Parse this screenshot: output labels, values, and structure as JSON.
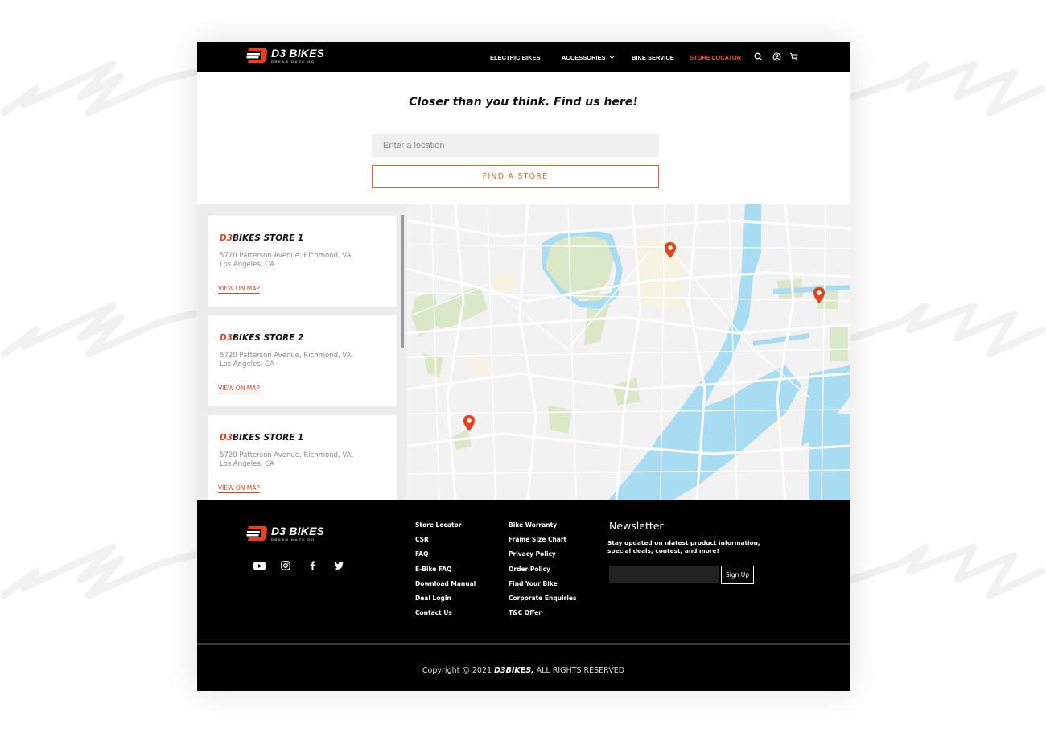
{
  "brand": {
    "name": "D3 BIKES",
    "tagline": "DREAM  DARE  DO",
    "accent_color": "#e3421b"
  },
  "nav": {
    "items": [
      {
        "label": "ELECTRIC BIKES",
        "active": false
      },
      {
        "label": "ACCESSORIES",
        "active": false,
        "has_dropdown": true
      },
      {
        "label": "BIKE SERVICE",
        "active": false
      },
      {
        "label": "STORE LOCATOR",
        "active": true
      }
    ],
    "icons": [
      "search-icon",
      "account-icon",
      "cart-icon"
    ]
  },
  "hero": {
    "title": "Closer than you think. Find us here!",
    "location_placeholder": "Enter a location",
    "location_value": "",
    "find_button": "FIND A STORE"
  },
  "stores": [
    {
      "brand": "D3",
      "name": "BIKES STORE 1",
      "address_line1": "5720 Patterson Avenue, Richmond, VA,",
      "address_line2": "Los Angeles, CA",
      "link": "VIEW ON MAP"
    },
    {
      "brand": "D3",
      "name": "BIKES STORE 2",
      "address_line1": "5720 Patterson Avenue, Richmond, VA,",
      "address_line2": "Los Angeles, CA",
      "link": "VIEW ON MAP"
    },
    {
      "brand": "D3",
      "name": "BIKES STORE 1",
      "address_line1": "5720 Patterson Avenue, Richmond, VA,",
      "address_line2": "Los Angeles, CA",
      "link": "VIEW ON MAP"
    }
  ],
  "map": {
    "pin_color": "#e3421b",
    "pin_count": 3
  },
  "footer": {
    "social": [
      "youtube-icon",
      "instagram-icon",
      "facebook-icon",
      "twitter-icon"
    ],
    "col1": [
      "Store Locator",
      "CSR",
      "FAQ",
      "E-Bike FAQ",
      "Download Manual",
      "Deal Login",
      "Contact Us"
    ],
    "col2": [
      "Bike Warranty",
      "Frame Size Chart",
      "Privacy Policy",
      "Order Policy",
      "Find Your Bike",
      "Corporate Enquiries",
      "T&C Offer"
    ],
    "newsletter": {
      "title": "Newsletter",
      "text": "Stay updated on nlatest product information, special deals, contest, and more!",
      "input_value": "",
      "button": "Sign Up"
    },
    "copyright_prefix": "Copyright @ 2021 ",
    "copyright_brand": "D3BIKES,",
    "copyright_suffix": " ALL RIGHTS RESERVED"
  }
}
